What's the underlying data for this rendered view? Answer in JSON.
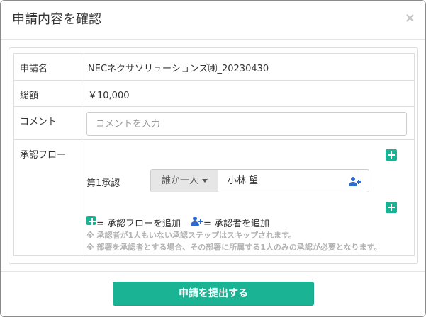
{
  "modal": {
    "title": "申請内容を確認",
    "close_label": "×"
  },
  "form": {
    "application_name_label": "申請名",
    "application_name_value": "NECネクサソリューションズ㈱_20230430",
    "amount_label": "総額",
    "amount_value": "￥10,000",
    "comment_label": "コメント",
    "comment_placeholder": "コメントを入力",
    "comment_value": "",
    "approval_flow_label": "承認フロー"
  },
  "approval_flow": {
    "steps": [
      {
        "label": "第1承認",
        "dropdown_label": "誰か一人",
        "approver": "小林 望"
      }
    ],
    "legend_add_flow": "= 承認フローを追加",
    "legend_add_approver": "= 承認者を追加",
    "notes": [
      "※ 承認者が1人もいない承認ステップはスキップされます。",
      "※ 部署を承認者とする場合、その部署に所属する1人のみの承認が必要となります。"
    ]
  },
  "footer": {
    "submit_label": "申請を提出する"
  },
  "colors": {
    "accent": "#1ab394",
    "user_icon": "#2e6bd1"
  },
  "icons": [
    "close-icon",
    "add-step-icon",
    "add-approver-icon",
    "chevron-down-icon"
  ]
}
